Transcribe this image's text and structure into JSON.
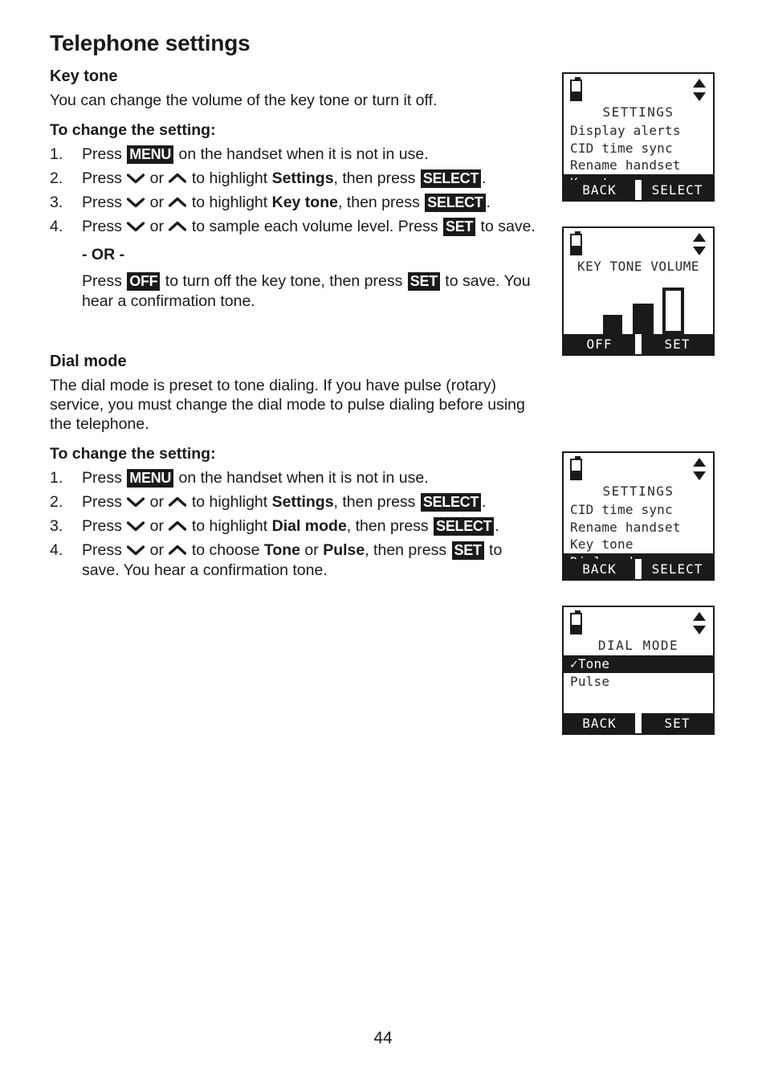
{
  "page": {
    "title": "Telephone settings",
    "number": "44"
  },
  "sections": [
    {
      "heading": "Key tone",
      "intro": "You can change the volume of the key tone or turn it off.",
      "sub_heading": "To change the setting:",
      "steps": [
        {
          "num": "1.",
          "parts": [
            {
              "t": "text",
              "v": "Press "
            },
            {
              "t": "kbd",
              "v": "MENU"
            },
            {
              "t": "text",
              "v": " on the handset when it is not in use."
            }
          ]
        },
        {
          "num": "2.",
          "parts": [
            {
              "t": "text",
              "v": "Press "
            },
            {
              "t": "icon",
              "v": "chevron-down-icon"
            },
            {
              "t": "text",
              "v": " or "
            },
            {
              "t": "icon",
              "v": "chevron-up-icon"
            },
            {
              "t": "text",
              "v": " to highlight "
            },
            {
              "t": "bold",
              "v": "Settings"
            },
            {
              "t": "text",
              "v": ", then press "
            },
            {
              "t": "kbd",
              "v": "SELECT"
            },
            {
              "t": "text",
              "v": "."
            }
          ]
        },
        {
          "num": "3.",
          "parts": [
            {
              "t": "text",
              "v": "Press "
            },
            {
              "t": "icon",
              "v": "chevron-down-icon"
            },
            {
              "t": "text",
              "v": " or "
            },
            {
              "t": "icon",
              "v": "chevron-up-icon"
            },
            {
              "t": "text",
              "v": " to highlight "
            },
            {
              "t": "bold",
              "v": "Key tone"
            },
            {
              "t": "text",
              "v": ", then press "
            },
            {
              "t": "kbd",
              "v": "SELECT"
            },
            {
              "t": "text",
              "v": "."
            }
          ]
        },
        {
          "num": "4.",
          "parts": [
            {
              "t": "text",
              "v": "Press "
            },
            {
              "t": "icon",
              "v": "chevron-down-icon"
            },
            {
              "t": "text",
              "v": " or "
            },
            {
              "t": "icon",
              "v": "chevron-up-icon"
            },
            {
              "t": "text",
              "v": " to sample each volume level. Press "
            },
            {
              "t": "kbd",
              "v": "SET"
            },
            {
              "t": "text",
              "v": " to save."
            }
          ],
          "or_label": "- OR -",
          "alt_parts": [
            {
              "t": "text",
              "v": "Press "
            },
            {
              "t": "kbd",
              "v": "OFF"
            },
            {
              "t": "text",
              "v": " to turn off the key tone, then press "
            },
            {
              "t": "kbd",
              "v": "SET"
            },
            {
              "t": "text",
              "v": " to save. You hear a confirmation tone."
            }
          ]
        }
      ]
    },
    {
      "heading": "Dial mode",
      "intro": "The dial mode is preset to tone dialing. If you have pulse (rotary) service, you must change the dial mode to pulse dialing before using the telephone.",
      "sub_heading": "To change the setting:",
      "steps": [
        {
          "num": "1.",
          "parts": [
            {
              "t": "text",
              "v": "Press "
            },
            {
              "t": "kbd",
              "v": "MENU"
            },
            {
              "t": "text",
              "v": " on the handset when it is not in use."
            }
          ]
        },
        {
          "num": "2.",
          "parts": [
            {
              "t": "text",
              "v": "Press "
            },
            {
              "t": "icon",
              "v": "chevron-down-icon"
            },
            {
              "t": "text",
              "v": " or "
            },
            {
              "t": "icon",
              "v": "chevron-up-icon"
            },
            {
              "t": "text",
              "v": " to highlight "
            },
            {
              "t": "bold",
              "v": "Settings"
            },
            {
              "t": "text",
              "v": ", then press "
            },
            {
              "t": "kbd",
              "v": "SELECT"
            },
            {
              "t": "text",
              "v": "."
            }
          ]
        },
        {
          "num": "3.",
          "parts": [
            {
              "t": "text",
              "v": "Press "
            },
            {
              "t": "icon",
              "v": "chevron-down-icon"
            },
            {
              "t": "text",
              "v": " or "
            },
            {
              "t": "icon",
              "v": "chevron-up-icon"
            },
            {
              "t": "text",
              "v": " to highlight "
            },
            {
              "t": "bold",
              "v": "Dial mode"
            },
            {
              "t": "text",
              "v": ", then press "
            },
            {
              "t": "kbd",
              "v": "SELECT"
            },
            {
              "t": "text",
              "v": "."
            }
          ]
        },
        {
          "num": "4.",
          "parts": [
            {
              "t": "text",
              "v": "Press "
            },
            {
              "t": "icon",
              "v": "chevron-down-icon"
            },
            {
              "t": "text",
              "v": " or "
            },
            {
              "t": "icon",
              "v": "chevron-up-icon"
            },
            {
              "t": "text",
              "v": " to choose "
            },
            {
              "t": "bold",
              "v": "Tone"
            },
            {
              "t": "text",
              "v": " or "
            },
            {
              "t": "bold",
              "v": "Pulse"
            },
            {
              "t": "text",
              "v": ", then press "
            },
            {
              "t": "kbd",
              "v": "SET"
            },
            {
              "t": "text",
              "v": " to save. You hear a confirmation tone."
            }
          ]
        }
      ]
    }
  ],
  "screens": [
    {
      "id": "settings-key-tone",
      "title": "SETTINGS",
      "rows": [
        {
          "label": "Display alerts",
          "selected": false
        },
        {
          "label": "CID time sync",
          "selected": false
        },
        {
          "label": "Rename handset",
          "selected": false
        },
        {
          "label": "Key tone",
          "selected": true
        }
      ],
      "softkeys": {
        "left": "BACK",
        "right": "SELECT"
      },
      "battery": {
        "level_pct": 45
      }
    },
    {
      "id": "key-tone-volume",
      "title": "KEY TONE VOLUME",
      "rows": [],
      "softkeys": {
        "left": "OFF",
        "right": "SET"
      },
      "battery": {
        "level_pct": 45
      },
      "volume": {
        "bars": [
          {
            "height_pct": 32,
            "filled": true
          },
          {
            "height_pct": 52,
            "filled": true
          },
          {
            "height_pct": 78,
            "filled": false
          }
        ]
      }
    },
    {
      "id": "settings-dial-mode",
      "title": "SETTINGS",
      "rows": [
        {
          "label": "CID time sync",
          "selected": false
        },
        {
          "label": "Rename handset",
          "selected": false
        },
        {
          "label": "Key tone",
          "selected": false
        },
        {
          "label": "Dial mode",
          "selected": true
        }
      ],
      "softkeys": {
        "left": "BACK",
        "right": "SELECT"
      },
      "battery": {
        "level_pct": 45
      }
    },
    {
      "id": "dial-mode-options",
      "title": "DIAL MODE",
      "rows": [
        {
          "label": "✓Tone",
          "selected": true
        },
        {
          "label": " Pulse",
          "selected": false
        }
      ],
      "softkeys": {
        "left": "BACK",
        "right": "SET"
      },
      "battery": {
        "level_pct": 45
      }
    }
  ],
  "colors": {
    "ink": "#1a1a1a",
    "paper": "#ffffff"
  }
}
